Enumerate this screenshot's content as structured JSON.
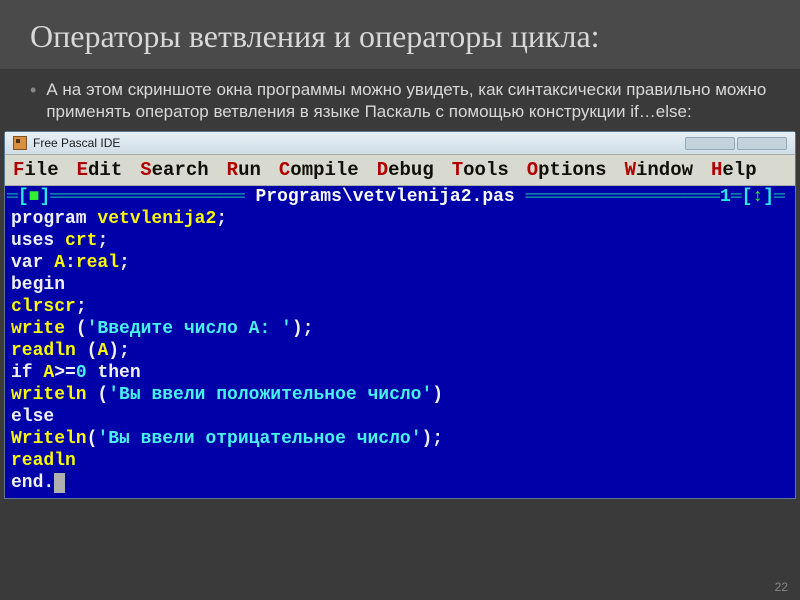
{
  "slide": {
    "title": "Операторы ветвления и операторы цикла:",
    "body": "А на этом скриншоте окна программы можно увидеть, как синтаксически правильно можно применять оператор ветвления в языке Паскаль с помощью конструкции if…else:",
    "page_num": "22"
  },
  "ide": {
    "win_title": "Free Pascal IDE",
    "menu": [
      {
        "hot": "F",
        "rest": "ile"
      },
      {
        "hot": "E",
        "rest": "dit"
      },
      {
        "hot": "S",
        "rest": "earch"
      },
      {
        "hot": "R",
        "rest": "un"
      },
      {
        "hot": "C",
        "rest": "ompile"
      },
      {
        "hot": "D",
        "rest": "ebug"
      },
      {
        "hot": "T",
        "rest": "ools"
      },
      {
        "hot": "O",
        "rest": "ptions"
      },
      {
        "hot": "W",
        "rest": "indow"
      },
      {
        "hot": "H",
        "rest": "elp"
      }
    ],
    "editor_title": " Programs\\vetvlenija2.pas ",
    "window_num": "1",
    "code": [
      [
        {
          "c": "white",
          "t": "program"
        },
        {
          "c": "yellow",
          "t": " vetvlenija2"
        },
        {
          "c": "white",
          "t": ";"
        }
      ],
      [
        {
          "c": "white",
          "t": "uses"
        },
        {
          "c": "yellow",
          "t": " crt"
        },
        {
          "c": "white",
          "t": ";"
        }
      ],
      [
        {
          "c": "white",
          "t": "var"
        },
        {
          "c": "yellow",
          "t": " A"
        },
        {
          "c": "white",
          "t": ":"
        },
        {
          "c": "yellow",
          "t": "real"
        },
        {
          "c": "white",
          "t": ";"
        }
      ],
      [
        {
          "c": "white",
          "t": "begin"
        }
      ],
      [
        {
          "c": "yellow",
          "t": "clrscr"
        },
        {
          "c": "white",
          "t": ";"
        }
      ],
      [
        {
          "c": "yellow",
          "t": "write "
        },
        {
          "c": "white",
          "t": "("
        },
        {
          "c": "cyan",
          "t": "'Введите число A: '"
        },
        {
          "c": "white",
          "t": ");"
        }
      ],
      [
        {
          "c": "yellow",
          "t": "readln "
        },
        {
          "c": "white",
          "t": "("
        },
        {
          "c": "yellow",
          "t": "A"
        },
        {
          "c": "white",
          "t": ");"
        }
      ],
      [
        {
          "c": "white",
          "t": "if"
        },
        {
          "c": "yellow",
          "t": " A"
        },
        {
          "c": "white",
          "t": ">="
        },
        {
          "c": "cyan",
          "t": "0"
        },
        {
          "c": "white",
          "t": " then"
        }
      ],
      [
        {
          "c": "yellow",
          "t": "writeln "
        },
        {
          "c": "white",
          "t": "("
        },
        {
          "c": "cyan",
          "t": "'Вы ввели положительное число'"
        },
        {
          "c": "white",
          "t": ")"
        }
      ],
      [
        {
          "c": "white",
          "t": "else"
        }
      ],
      [
        {
          "c": "yellow",
          "t": "Writeln"
        },
        {
          "c": "white",
          "t": "("
        },
        {
          "c": "cyan",
          "t": "'Вы ввели отрицательное число'"
        },
        {
          "c": "white",
          "t": ");"
        }
      ],
      [
        {
          "c": "yellow",
          "t": "readln"
        }
      ],
      [
        {
          "c": "white",
          "t": "end."
        },
        {
          "c": "cursor",
          "t": " "
        }
      ]
    ]
  }
}
